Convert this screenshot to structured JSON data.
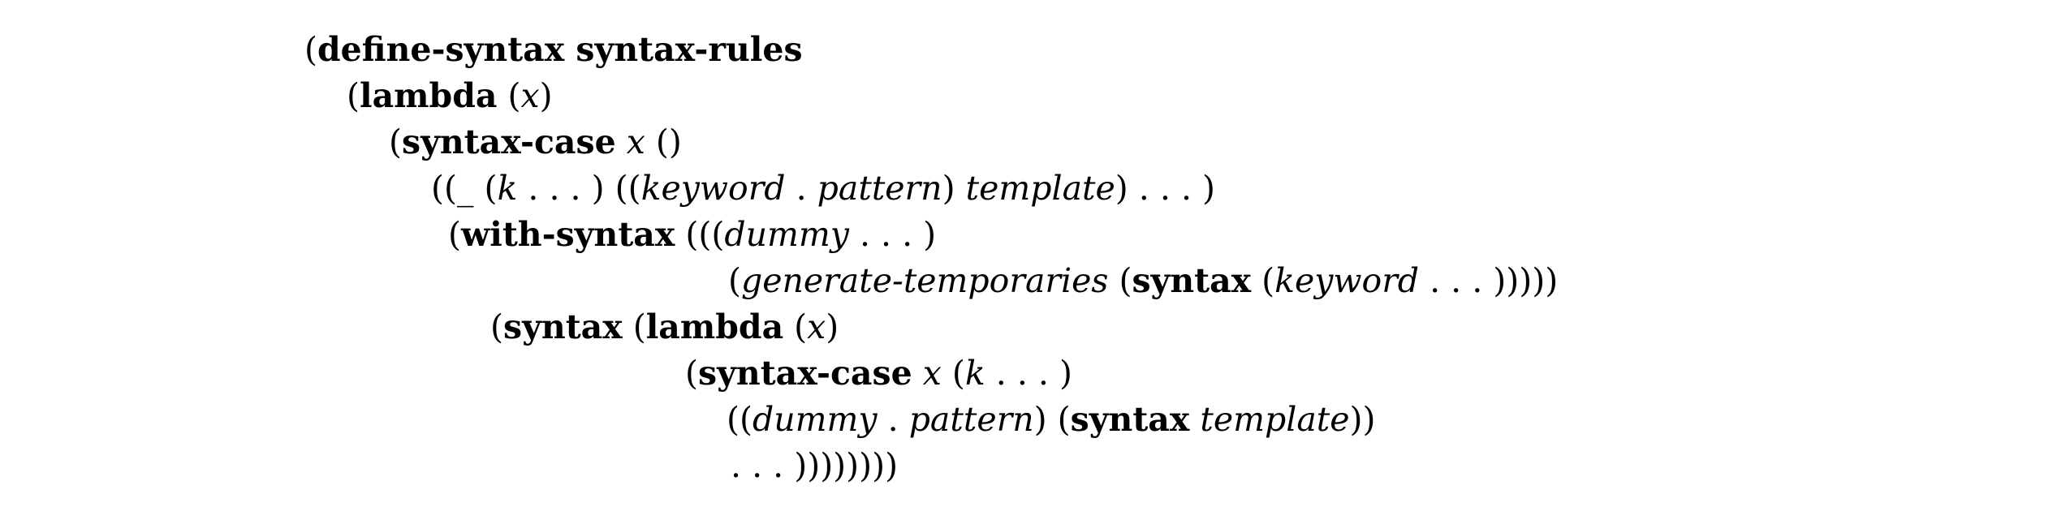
{
  "code": {
    "lines": [
      {
        "segments": [
          {
            "text": "(",
            "style": "roman"
          },
          {
            "text": "define-syntax syntax-rules",
            "style": "bold"
          }
        ]
      },
      {
        "segments": [
          {
            "text": "(",
            "style": "roman"
          },
          {
            "text": "lambda",
            "style": "bold"
          },
          {
            "text": " (",
            "style": "roman"
          },
          {
            "text": "x",
            "style": "italic"
          },
          {
            "text": ")",
            "style": "roman"
          }
        ]
      },
      {
        "segments": [
          {
            "text": "(",
            "style": "roman"
          },
          {
            "text": "syntax-case",
            "style": "bold"
          },
          {
            "text": " ",
            "style": "roman"
          },
          {
            "text": "x",
            "style": "italic"
          },
          {
            "text": " ()",
            "style": "roman"
          }
        ]
      },
      {
        "segments": [
          {
            "text": "((_ (",
            "style": "roman"
          },
          {
            "text": "k",
            "style": "italic"
          },
          {
            "text": " . . . ) ((",
            "style": "roman"
          },
          {
            "text": "keyword",
            "style": "italic"
          },
          {
            "text": " . ",
            "style": "roman"
          },
          {
            "text": "pattern",
            "style": "italic"
          },
          {
            "text": ") ",
            "style": "roman"
          },
          {
            "text": "template",
            "style": "italic"
          },
          {
            "text": ") . . . )",
            "style": "roman"
          }
        ]
      },
      {
        "segments": [
          {
            "text": "(",
            "style": "roman"
          },
          {
            "text": "with-syntax",
            "style": "bold"
          },
          {
            "text": " (((",
            "style": "roman"
          },
          {
            "text": "dummy",
            "style": "italic"
          },
          {
            "text": " . . . )",
            "style": "roman"
          }
        ]
      },
      {
        "segments": [
          {
            "text": "(",
            "style": "roman"
          },
          {
            "text": "generate-temporaries",
            "style": "italic"
          },
          {
            "text": " (",
            "style": "roman"
          },
          {
            "text": "syntax",
            "style": "bold"
          },
          {
            "text": " (",
            "style": "roman"
          },
          {
            "text": "keyword",
            "style": "italic"
          },
          {
            "text": " . . . )))))",
            "style": "roman"
          }
        ]
      },
      {
        "segments": [
          {
            "text": "(",
            "style": "roman"
          },
          {
            "text": "syntax",
            "style": "bold"
          },
          {
            "text": " (",
            "style": "roman"
          },
          {
            "text": "lambda",
            "style": "bold"
          },
          {
            "text": " (",
            "style": "roman"
          },
          {
            "text": "x",
            "style": "italic"
          },
          {
            "text": ")",
            "style": "roman"
          }
        ]
      },
      {
        "segments": [
          {
            "text": "(",
            "style": "roman"
          },
          {
            "text": "syntax-case",
            "style": "bold"
          },
          {
            "text": " ",
            "style": "roman"
          },
          {
            "text": "x",
            "style": "italic"
          },
          {
            "text": " (",
            "style": "roman"
          },
          {
            "text": "k",
            "style": "italic"
          },
          {
            "text": " . . . )",
            "style": "roman"
          }
        ]
      },
      {
        "segments": [
          {
            "text": "((",
            "style": "roman"
          },
          {
            "text": "dummy",
            "style": "italic"
          },
          {
            "text": " . ",
            "style": "roman"
          },
          {
            "text": "pattern",
            "style": "italic"
          },
          {
            "text": ") (",
            "style": "roman"
          },
          {
            "text": "syntax",
            "style": "bold"
          },
          {
            "text": " ",
            "style": "roman"
          },
          {
            "text": "template",
            "style": "italic"
          },
          {
            "text": "))",
            "style": "roman"
          }
        ]
      },
      {
        "segments": [
          {
            "text": ". . . ))))))))",
            "style": "roman"
          }
        ]
      }
    ]
  }
}
